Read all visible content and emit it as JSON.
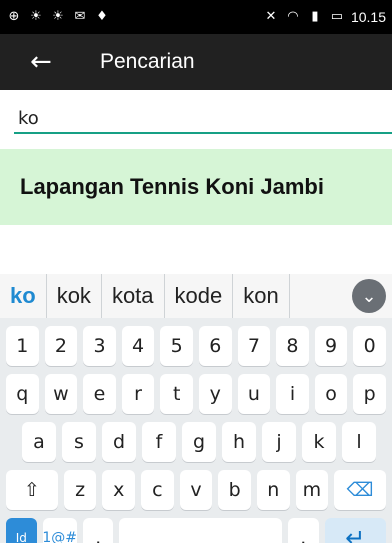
{
  "status": {
    "time": "10.15",
    "left_icons": [
      "mail-icon",
      "flame-icon",
      "flame-icon",
      "envelope-icon",
      "shield-icon"
    ],
    "right_icons": [
      "mute-icon",
      "wifi-icon",
      "signal-icon",
      "battery-icon"
    ]
  },
  "appbar": {
    "title": "Pencarian",
    "back_icon": "back-arrow-icon"
  },
  "search": {
    "value": "ko",
    "placeholder": ""
  },
  "result": {
    "label": "Lapangan Tennis Koni Jambi"
  },
  "keyboard": {
    "suggestions": [
      "ko",
      "kok",
      "kota",
      "kode",
      "kon"
    ],
    "row1": [
      "1",
      "2",
      "3",
      "4",
      "5",
      "6",
      "7",
      "8",
      "9",
      "0"
    ],
    "row2": [
      "q",
      "w",
      "e",
      "r",
      "t",
      "y",
      "u",
      "i",
      "o",
      "p"
    ],
    "row3": [
      "a",
      "s",
      "d",
      "f",
      "g",
      "h",
      "j",
      "k",
      "l"
    ],
    "row4": [
      "z",
      "x",
      "c",
      "v",
      "b",
      "n",
      "m"
    ],
    "mode_label": "Id",
    "num_label": "1@#",
    "comma_label": ",",
    "period_label": ".",
    "space_label": "",
    "enter_label": "↵"
  }
}
